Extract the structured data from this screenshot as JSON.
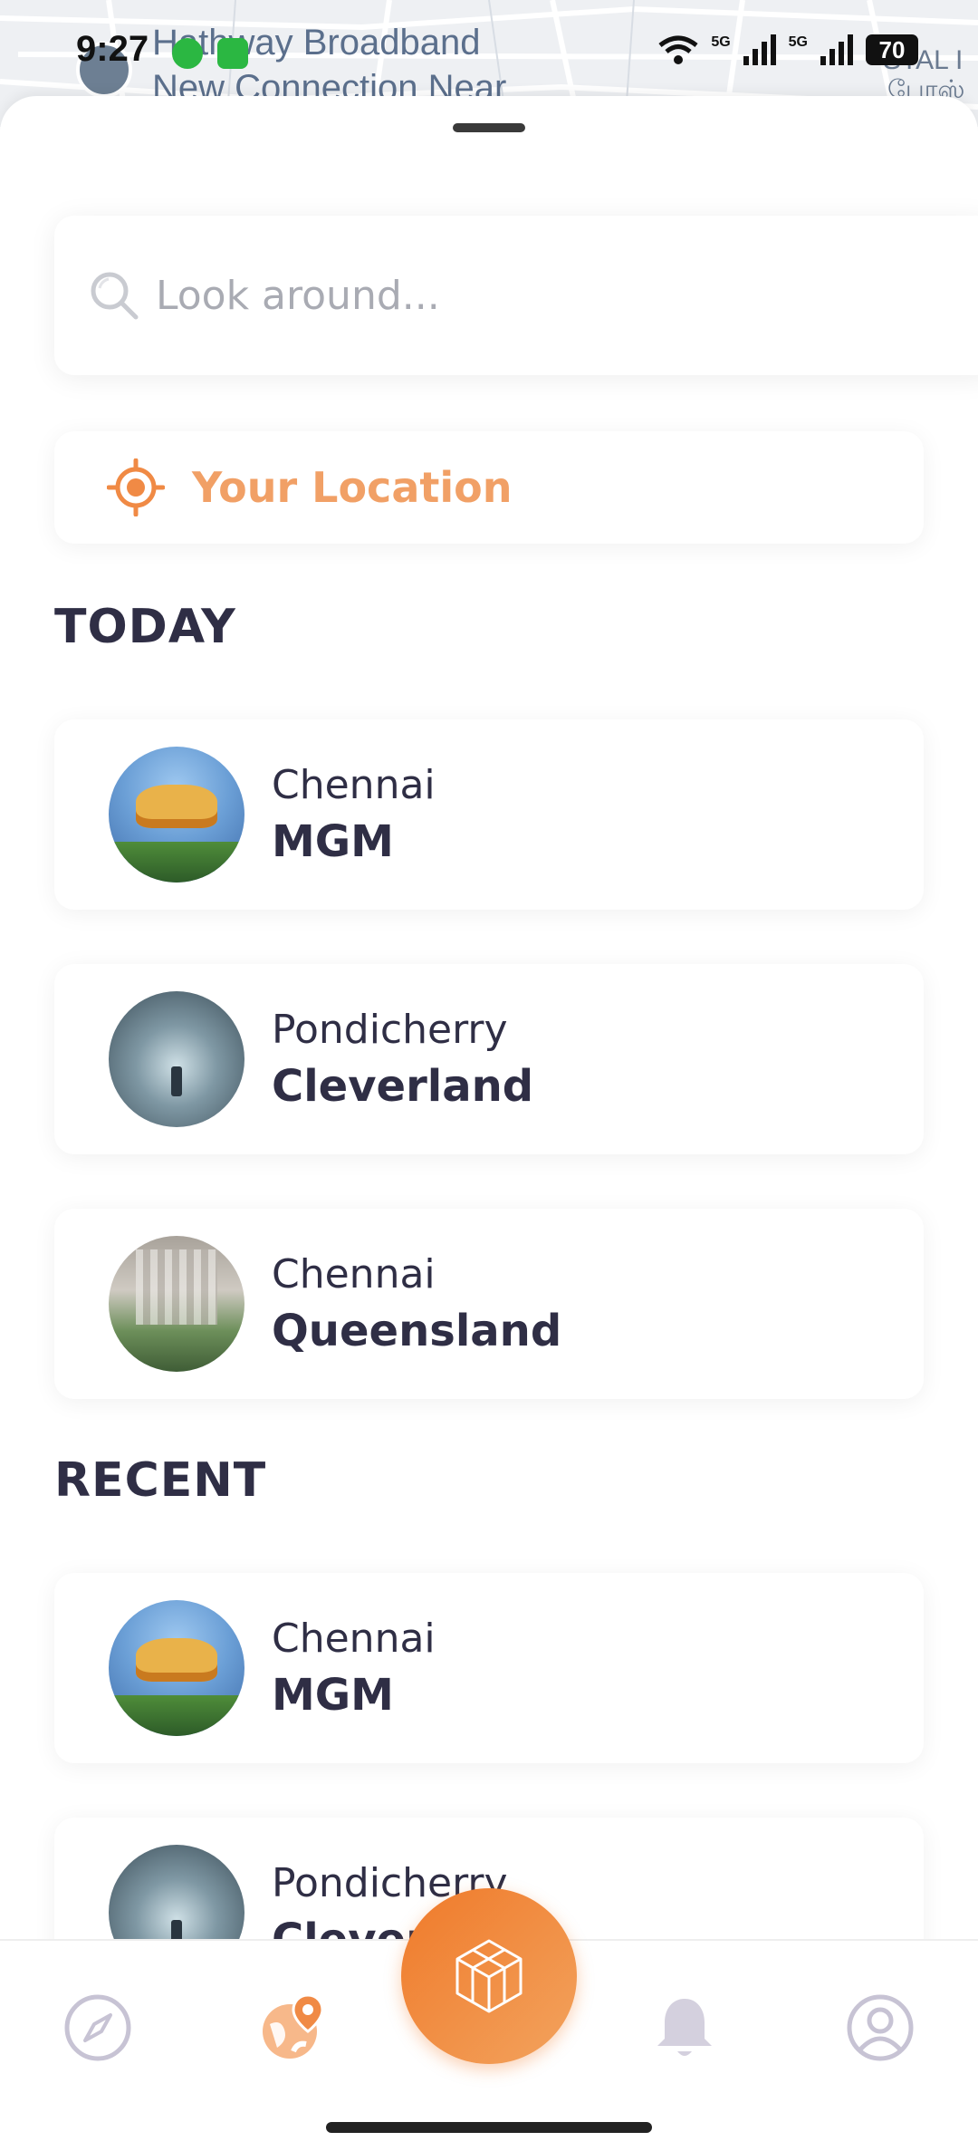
{
  "status_bar": {
    "time": "9:27",
    "network_1": "5G",
    "network_2": "5G",
    "battery": "70"
  },
  "map_background": {
    "label_line_1": "Hathway Broadband",
    "label_line_2": "New Connection Near",
    "label_right_1": "STAL I",
    "label_right_2": "போஸ்"
  },
  "search": {
    "placeholder": "Look around..."
  },
  "location_button": {
    "label": "Your Location",
    "accent_color": "#f1a066"
  },
  "sections": {
    "today": {
      "title": "TODAY",
      "items": [
        {
          "city": "Chennai",
          "name": "MGM",
          "image": "dizzee-world-entrance"
        },
        {
          "city": "Pondicherry",
          "name": "Cleverland",
          "image": "tunnel-corridor"
        },
        {
          "city": "Chennai",
          "name": "Queensland",
          "image": "waterfall-park"
        }
      ]
    },
    "recent": {
      "title": "RECENT",
      "items": [
        {
          "city": "Chennai",
          "name": "MGM",
          "image": "dizzee-world-entrance"
        },
        {
          "city": "Pondicherry",
          "name": "Cleverland",
          "image": "tunnel-corridor"
        }
      ]
    }
  },
  "bottom_nav": {
    "items": [
      {
        "icon": "compass-icon",
        "active": false
      },
      {
        "icon": "globe-pin-icon",
        "active": true
      },
      {
        "icon": "cube-icon",
        "active": false
      },
      {
        "icon": "bell-icon",
        "active": false
      },
      {
        "icon": "user-icon",
        "active": false
      }
    ],
    "accent_color": "#f07a2a"
  }
}
